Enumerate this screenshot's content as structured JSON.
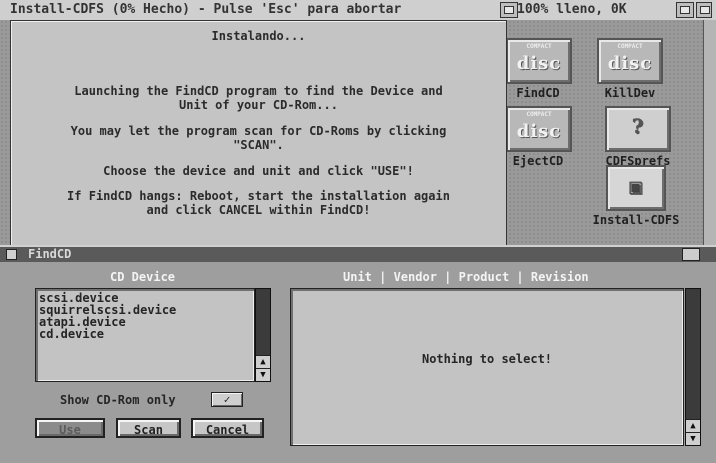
{
  "titlebar": {
    "title": "Install-CDFS (0% Hecho) - Pulse 'Esc' para abortar",
    "status": "100% lleno, 0K"
  },
  "install_dialog": {
    "heading": "Instalando...",
    "lines": [
      "Launching the FindCD program to find the Device and",
      "Unit of your CD-Rom...",
      "You may let the program scan for CD-Roms by clicking",
      "\"SCAN\".",
      "Choose the device and unit and click \"USE\"!",
      "If FindCD hangs: Reboot, start the installation again",
      "and click CANCEL within FindCD!"
    ]
  },
  "desktop_icons": {
    "findcd": {
      "label": "FindCD",
      "glyph": "disc",
      "icon": "cd-disc-icon"
    },
    "killdev": {
      "label": "KillDev",
      "glyph": "disc",
      "icon": "cd-disc-icon"
    },
    "ejectcd": {
      "label": "EjectCD",
      "glyph": "disc",
      "icon": "cd-disc-icon"
    },
    "cdfsprefs": {
      "label": "CDFSprefs",
      "glyph": "?",
      "icon": "prefs-icon"
    },
    "install_cdfs": {
      "label": "Install-CDFS",
      "glyph": "▣",
      "icon": "installer-icon"
    }
  },
  "findcd_window": {
    "title": "FindCD",
    "cd_device_header": "CD Device",
    "devices": [
      "scsi.device",
      "squirrelscsi.device",
      "atapi.device",
      "cd.device"
    ],
    "unit_header": "Unit | Vendor | Product | Revision",
    "empty_message": "Nothing to select!",
    "show_cdrom_label": "Show CD-Rom only",
    "show_cdrom_checked": "✓",
    "buttons": {
      "use": "Use",
      "scan": "Scan",
      "cancel": "Cancel"
    }
  }
}
